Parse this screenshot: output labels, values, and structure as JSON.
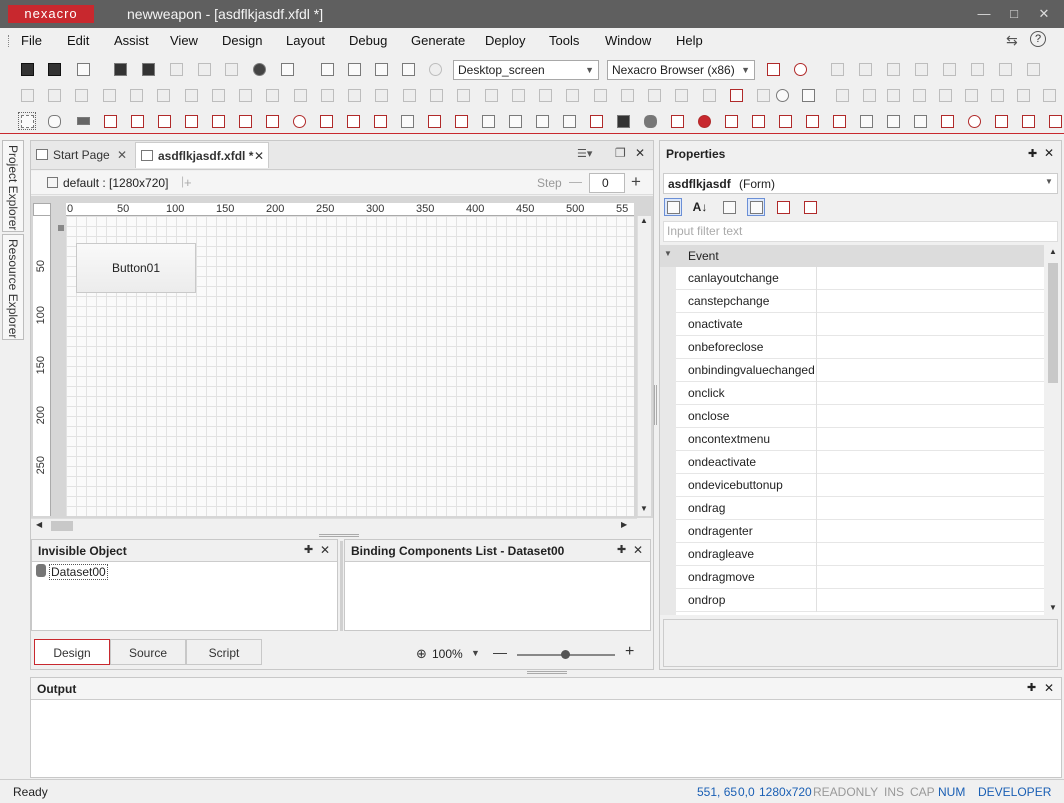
{
  "app": {
    "logo": "nexacro",
    "title": "newweapon - [asdflkjasdf.xfdl *]"
  },
  "window_controls": {
    "minimize": "—",
    "maximize": "□",
    "close": "✕"
  },
  "menu": [
    {
      "label": "File"
    },
    {
      "label": "Edit"
    },
    {
      "label": "Assist"
    },
    {
      "label": "View"
    },
    {
      "label": "Design"
    },
    {
      "label": "Layout"
    },
    {
      "label": "Debug"
    },
    {
      "label": "Generate"
    },
    {
      "label": "Deploy"
    },
    {
      "label": "Tools"
    },
    {
      "label": "Window"
    },
    {
      "label": "Help"
    }
  ],
  "toolbar": {
    "screen_select": "Desktop_screen",
    "browser_select": "Nexacro Browser (x86)"
  },
  "sidebar": {
    "project_explorer": "Project Explorer",
    "resource_explorer": "Resource Explorer"
  },
  "editor": {
    "tabs": [
      {
        "label": "Start Page"
      },
      {
        "label": "asdflkjasdf.xfdl *"
      }
    ],
    "layout_label": "default : [1280x720]",
    "step_label": "Step",
    "step_value": "0",
    "ruler_h": [
      "0",
      "50",
      "100",
      "150",
      "200",
      "250",
      "300",
      "350",
      "400",
      "450",
      "500",
      "55"
    ],
    "ruler_v": [
      "0",
      "50",
      "100",
      "150",
      "200",
      "250"
    ],
    "button_label": "Button01"
  },
  "invisible_object": {
    "title": "Invisible Object",
    "items": [
      "Dataset00"
    ]
  },
  "binding": {
    "title": "Binding Components List - Dataset00"
  },
  "bottom_tabs": {
    "design": "Design",
    "source": "Source",
    "script": "Script"
  },
  "zoom": {
    "value": "100%"
  },
  "properties": {
    "title": "Properties",
    "object_name": "asdflkjasdf",
    "object_type": "(Form)",
    "filter_placeholder": "Input filter text",
    "group": "Event",
    "events": [
      "canlayoutchange",
      "canstepchange",
      "onactivate",
      "onbeforeclose",
      "onbindingvaluechanged",
      "onclick",
      "onclose",
      "oncontextmenu",
      "ondeactivate",
      "ondevicebuttonup",
      "ondrag",
      "ondragenter",
      "ondragleave",
      "ondragmove",
      "ondrop"
    ]
  },
  "output": {
    "title": "Output"
  },
  "status": {
    "ready": "Ready",
    "coords": "551, 65",
    "pos": "0,0",
    "size": "1280x720",
    "readonly": "READONLY",
    "ins": "INS",
    "cap": "CAP",
    "num": "NUM",
    "mode": "DEVELOPER"
  },
  "colors": {
    "accent": "#c8282e",
    "titlebar": "#5f5f5f",
    "status_blue": "#1a5fb4"
  }
}
